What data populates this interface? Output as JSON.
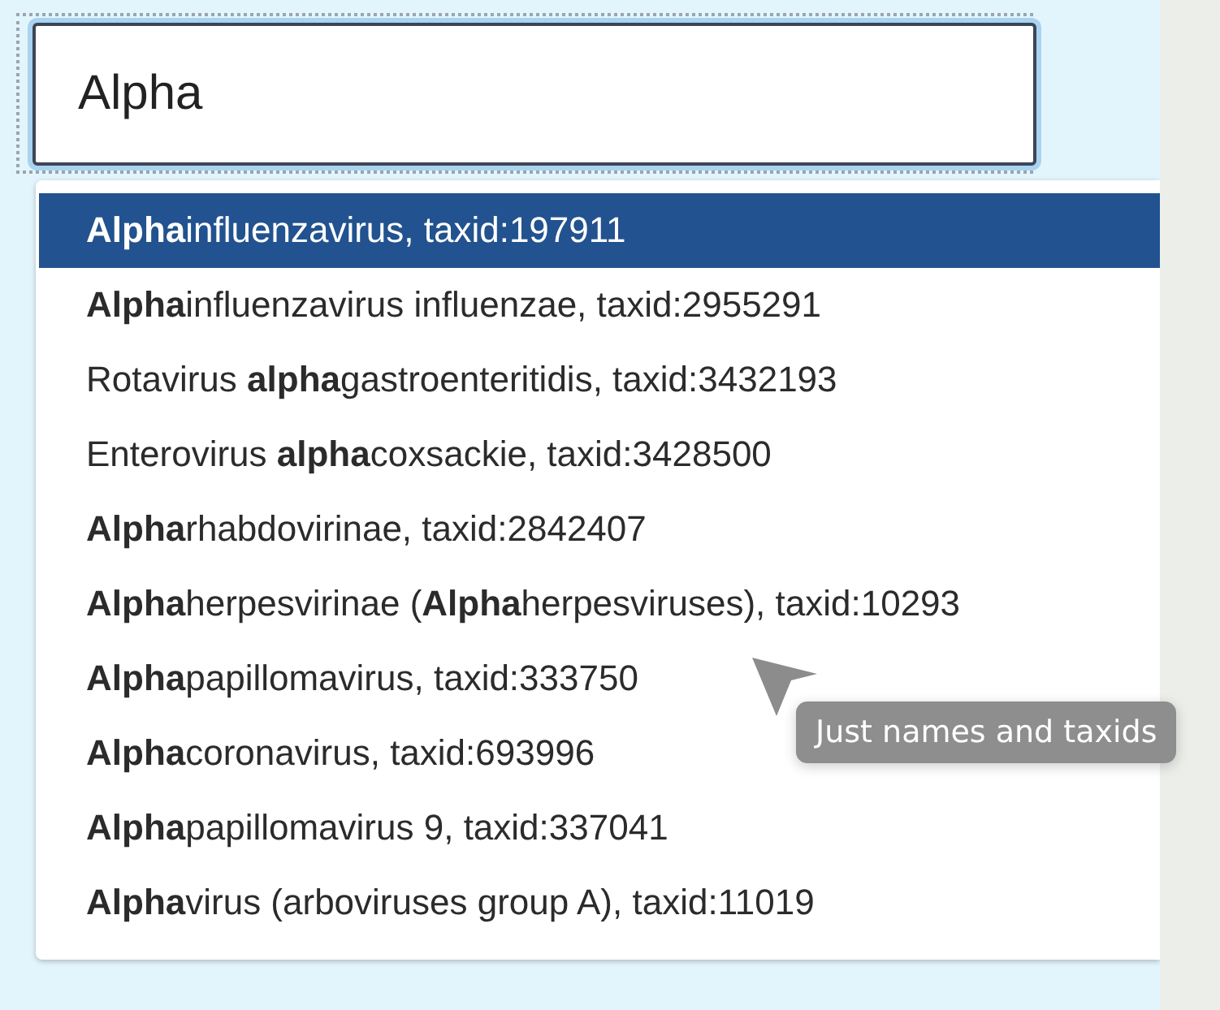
{
  "search": {
    "value": "Alpha"
  },
  "suggestions": [
    {
      "label": "**Alpha**influenzavirus, taxid:197911",
      "selected": true
    },
    {
      "label": "**Alpha**influenzavirus influenzae, taxid:2955291",
      "selected": false
    },
    {
      "label": "Rotavirus **alpha**gastroenteritidis, taxid:3432193",
      "selected": false
    },
    {
      "label": "Enterovirus **alpha**coxsackie, taxid:3428500",
      "selected": false
    },
    {
      "label": "**Alpha**rhabdovirinae, taxid:2842407",
      "selected": false
    },
    {
      "label": "**Alpha**herpesvirinae (**Alpha**herpesviruses), taxid:10293",
      "selected": false
    },
    {
      "label": "**Alpha**papillomavirus, taxid:333750",
      "selected": false
    },
    {
      "label": "**Alpha**coronavirus, taxid:693996",
      "selected": false
    },
    {
      "label": "**Alpha**papillomavirus 9, taxid:337041",
      "selected": false
    },
    {
      "label": "**Alpha**virus (arboviruses group A), taxid:11019",
      "selected": false
    }
  ],
  "tooltip": {
    "text": "Just names and taxids"
  }
}
